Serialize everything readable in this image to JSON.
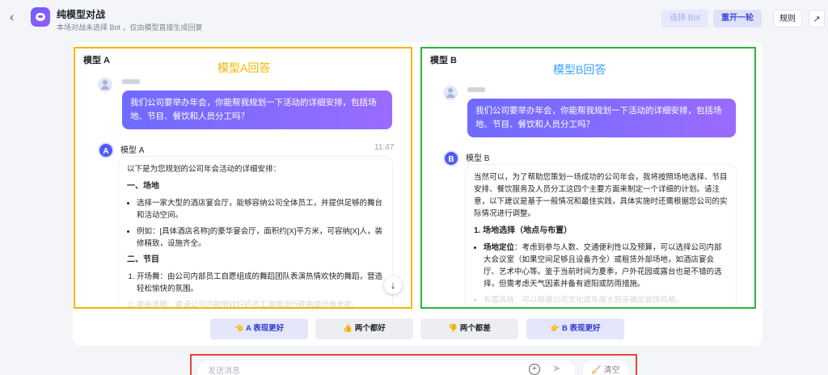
{
  "header": {
    "back_icon": "chevron-left-icon",
    "title": "纯模型对战",
    "subtitle": "本场对战未选择 Bot ，仅由模型直接生成回复",
    "select_bot_label": "选择 Bot",
    "restart_label": "重开一轮",
    "rules_label": "规则",
    "share_icon": "share-icon"
  },
  "panel_a": {
    "label": "模型 A",
    "annotation": "模型A回答",
    "user_message": "我们公司要举办年会，你能帮我规划一下活动的详细安排，包括场地、节目、餐饮和人员分工吗？",
    "bot_avatar": "A",
    "bot_name": "模型 A",
    "bot_time": "11:47",
    "answer": {
      "intro": "以下是为您规划的公司年会活动的详细安排：",
      "h1": "一、场地",
      "li1": "选择一家大型的酒店宴会厅，能够容纳公司全体员工，并提供足够的舞台和活动空间。",
      "li2": "例如：[具体酒店名称]的豪华宴会厅，面积约[X]平方米，可容纳[X]人，装修精致，设施齐全。",
      "h2": "二、节目",
      "li3": "开场舞：由公司内部员工自愿组成的舞蹈团队表演热情欢快的舞蹈，营造轻松愉快的氛围。",
      "li4": "歌曲演唱：邀请公司内歌唱较好的员工演唱流行歌曲或经典老歌。"
    }
  },
  "panel_b": {
    "label": "模型 B",
    "annotation": "模型B回答",
    "user_message": "我们公司要举办年会，你能帮我规划一下活动的详细安排，包括场地、节目、餐饮和人员分工吗？",
    "bot_avatar": "B",
    "bot_name": "模型 B",
    "answer": {
      "intro": "当然可以，为了帮助您策划一场成功的公司年会，我将按照场地选择、节目安排、餐饮服务及人员分工这四个主要方面来制定一个详细的计划。请注意，以下建议是基于一般情况和最佳实践，具体实施时还需根据您公司的实际情况进行调整。",
      "h1": "1. 场地选择（地点与布置）",
      "li1_strong": "场地定位",
      "li1": "：考虑到参与人数、交通便利性以及预算，可以选择公司内部大会议室（如果空间足够且设备齐全）或租赁外部场地，如酒店宴会厅、艺术中心等。鉴于当前时间为夏季，户外花园或露台也是不错的选择，但需考虑天气因素并备有遮阳或防雨措施。",
      "li2": "布置风格：可以根据公司文化或年度主题来确定装饰风格。"
    }
  },
  "votes": {
    "a_better": "A 表现更好",
    "both_good": "两个都好",
    "both_bad": "两个都差",
    "b_better": "B 表现更好"
  },
  "composer": {
    "placeholder": "发送消息",
    "clear_label": "清空"
  }
}
